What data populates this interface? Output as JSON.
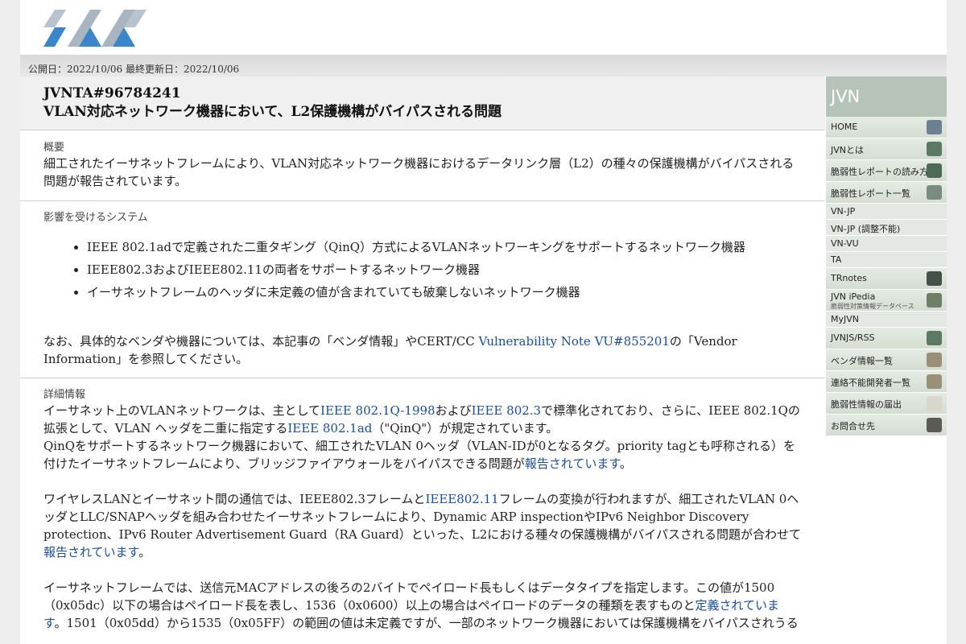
{
  "dates": {
    "published": "公開日：2022/10/06",
    "updated": "最終更新日：2022/10/06"
  },
  "vuid": "JVNTA#96784241",
  "title": "VLAN対応ネットワーク機器において、L2保護機構がバイパスされる問題",
  "overview": {
    "label": "概要",
    "text": "細工されたイーサネットフレームにより、VLAN対応ネットワーク機器におけるデータリンク層（L2）の種々の保護機構がバイパスされる問題が報告されています。"
  },
  "affected": {
    "label": "影響を受けるシステム",
    "items": [
      "IEEE 802.1adで定義された二重タギング（QinQ）方式によるVLANネットワーキングをサポートするネットワーク機器",
      "IEEE802.3およびIEEE802.11の両者をサポートするネットワーク機器",
      "イーサネットフレームのヘッダに未定義の値が含まれていても破棄しないネットワーク機器"
    ],
    "note_pre": "なお、具体的なベンダや機器については、本記事の「ベンダ情報」やCERT/CC ",
    "note_link": "Vulnerability Note VU#855201",
    "note_post": "の「Vendor Information」を参照してください。"
  },
  "details": {
    "label": "詳細情報",
    "p1": {
      "t1": "イーサネット上のVLANネットワークは、主として",
      "l1": "IEEE 802.1Q-1998",
      "t2": "および",
      "l2": "IEEE 802.3",
      "t3": "で標準化されており、さらに、IEEE 802.1Qの拡張として、VLAN ヘッダを二重に指定する",
      "l3": "IEEE 802.1ad",
      "t4": "（\"QinQ\"）が規定されています。",
      "t5": "QinQをサポートするネットワーク機器において、細工されたVLAN 0ヘッダ（VLAN-IDが0となるタグ。priority tagとも呼称される）を付けたイーサネットフレームにより、ブリッジファイアウォールをバイパスできる問題が",
      "l4": "報告されています",
      "t6": "。"
    },
    "p2": {
      "t1": "ワイヤレスLANとイーサネット間の通信では、IEEE802.3フレームと",
      "l1": "IEEE802.11",
      "t2": "フレームの変換が行われますが、細工されたVLAN 0ヘッダとLLC/SNAPヘッダを組み合わせたイーサネットフレームにより、Dynamic ARP inspectionやIPv6 Neighbor Discovery protection、IPv6 Router Advertisement Guard（RA Guard）といった、L2における種々の保護機構がバイパスされる問題が合わせて",
      "l2": "報告されています",
      "t3": "。"
    },
    "p3": {
      "t1": "イーサネットフレームでは、送信元MACアドレスの後ろの2バイトでペイロード長もしくはデータタイプを指定します。この値が1500（0x05dc）以下の場合はペイロード長を表し、1536（0x0600）以上の場合はペイロードのデータの種類を表すものと",
      "l1": "定義されています",
      "t2": "。1501（0x05dd）から1535（0x05FF）の範囲の値は未定義ですが、一部のネットワーク機器においては保護機構をバイパスされうる"
    }
  },
  "sidebar": {
    "head": "JVN",
    "items": [
      {
        "label": "HOME",
        "kind": "big",
        "icon": "building-icon"
      },
      {
        "label": "JVNとは",
        "kind": "big",
        "icon": "globe-icon"
      },
      {
        "label": "脆弱性レポートの読み方",
        "kind": "big",
        "icon": "eye-icon"
      },
      {
        "label": "脆弱性レポート一覧",
        "kind": "big",
        "icon": "stairs-icon"
      },
      {
        "label": "VN-JP",
        "kind": "small"
      },
      {
        "label": "VN-JP (調整不能)",
        "kind": "small"
      },
      {
        "label": "VN-VU",
        "kind": "small"
      },
      {
        "label": "TA",
        "kind": "small"
      },
      {
        "label": "TRnotes",
        "kind": "big",
        "icon": "pen-icon"
      },
      {
        "label": "JVN iPedia",
        "sub": "脆弱性対策情報データベース",
        "kind": "big",
        "icon": "texture-icon"
      },
      {
        "label": "MyJVN",
        "kind": "small"
      },
      {
        "label": "JVNJS/RSS",
        "kind": "big",
        "icon": "globe-icon"
      },
      {
        "label": "ベンダ情報一覧",
        "kind": "big",
        "icon": "hands-icon"
      },
      {
        "label": "連絡不能開発者一覧",
        "kind": "big",
        "icon": "hands-icon"
      },
      {
        "label": "脆弱性情報の届出",
        "kind": "big",
        "icon": "envelope-icon"
      },
      {
        "label": "お問合せ先",
        "kind": "big",
        "icon": "person-icon"
      }
    ]
  },
  "colors": {
    "link": "#1a4e9c",
    "logo_blue": "#3a86c8",
    "logo_gray": "#a9b6c2",
    "sidebar_head": "#b6c3b8"
  }
}
